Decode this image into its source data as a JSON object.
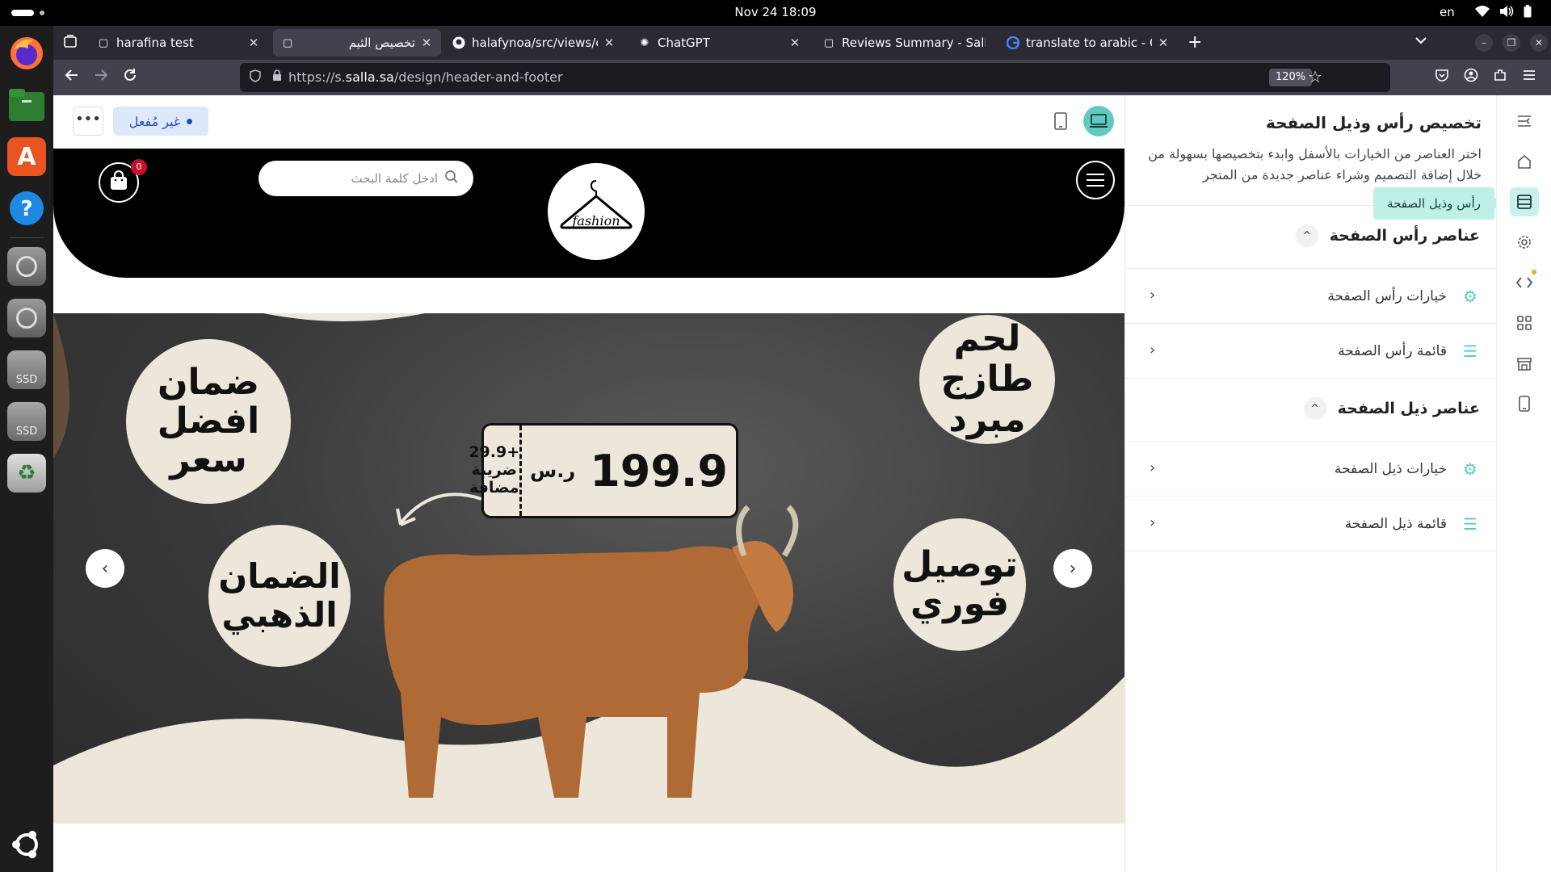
{
  "system": {
    "clock": "Nov 24  18:09",
    "language": "en"
  },
  "dock": {
    "items": [
      "firefox-icon",
      "files-icon",
      "app-center-icon",
      "help-icon",
      "disc-icon",
      "disc-icon",
      "ssd-drive-icon",
      "ssd-drive-icon",
      "trash-icon",
      "ubuntu-logo-icon"
    ],
    "ssd_label": "SSD"
  },
  "browser": {
    "tabs": [
      {
        "title": "harafina test",
        "icon": "salla-icon"
      },
      {
        "title": "تخصيص الثيم",
        "icon": "salla-icon"
      },
      {
        "title": "halafynoa/src/views/com",
        "icon": "github-icon"
      },
      {
        "title": "ChatGPT",
        "icon": "openai-icon"
      },
      {
        "title": "Reviews Summary - Salla",
        "icon": "salla-icon"
      },
      {
        "title": "translate to arabic - Goog",
        "icon": "google-icon"
      }
    ],
    "active_tab": 1,
    "url_prefix": "https://s.",
    "url_domain": "salla.sa",
    "url_path": "/design/header-and-footer",
    "zoom": "120%"
  },
  "preview": {
    "status_badge": "غير مُفعل",
    "search_placeholder": "ادخل كلمة البحث",
    "logo_text": "fashion",
    "cart_count": "0",
    "banner": {
      "bubbles": {
        "fresh_meat": [
          "لحم طازج",
          "مبرد"
        ],
        "best_price": [
          "ضمان",
          "افضل",
          "سعر"
        ],
        "delivery": [
          "توصيل",
          "فوري"
        ],
        "golden": [
          "الضمان",
          "الذهبي"
        ]
      },
      "price": "199.9",
      "currency": "ر.س",
      "vat_amount": "+29.9",
      "vat_label_1": "ضريبة",
      "vat_label_2": "مضافة"
    }
  },
  "settings": {
    "title": "تخصيص رأس وذيل الصفحة",
    "description": "اختر العناصر من الخيارات بالأسفل وابدء بتخصيصها بسهولة من خلال إضافة التصميم وشراء عناصر جديدة من المتجر",
    "header_section": {
      "title": "عناصر رأس الصفحة",
      "items": [
        "خيارات رأس الصفحة",
        "قائمة رأس الصفحة"
      ]
    },
    "footer_section": {
      "title": "عناصر ذيل الصفحة",
      "items": [
        "خيارات ذيل الصفحة",
        "قائمة ذيل الصفحة"
      ]
    },
    "tooltip": "رأس وذيل الصفحة"
  },
  "colors": {
    "accent": "#5fcac0",
    "accent_light": "#c9f1ec",
    "badge_bg": "#dde9fb",
    "badge_text": "#1f4fbf",
    "cart_badge": "#c8102e"
  }
}
